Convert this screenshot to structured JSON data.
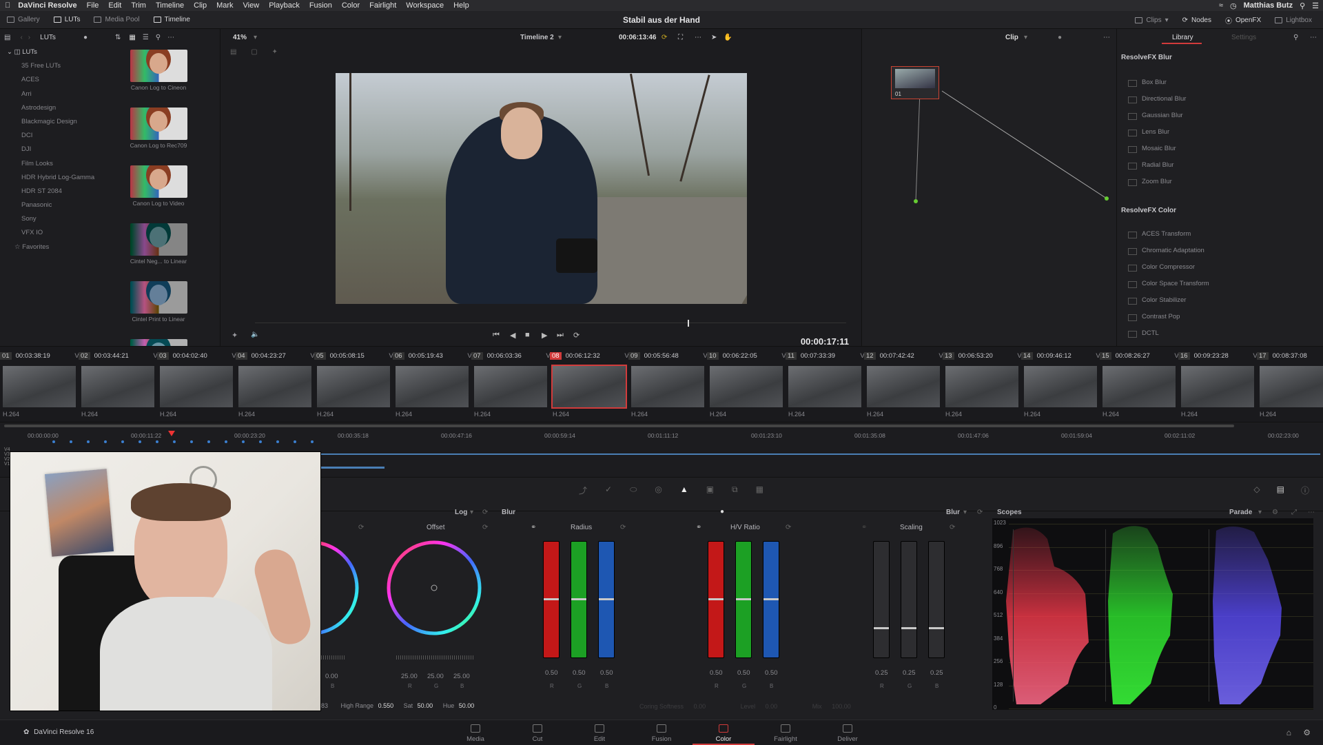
{
  "menubar": {
    "app": "DaVinci Resolve",
    "items": [
      "File",
      "Edit",
      "Trim",
      "Timeline",
      "Clip",
      "Mark",
      "View",
      "Playback",
      "Fusion",
      "Color",
      "Fairlight",
      "Workspace",
      "Help"
    ],
    "user": "Matthias Butz"
  },
  "toolbar": {
    "left": [
      "Gallery",
      "LUTs",
      "Media Pool",
      "Timeline"
    ],
    "project_title": "Stabil aus der Hand",
    "right": [
      "Clips",
      "Nodes",
      "OpenFX",
      "Lightbox"
    ]
  },
  "luts": {
    "panel_title": "LUTs",
    "tree_root": "LUTs",
    "tree": [
      "35 Free LUTs",
      "ACES",
      "Arri",
      "Astrodesign",
      "Blackmagic Design",
      "DCI",
      "DJI",
      "Film Looks",
      "HDR Hybrid Log-Gamma",
      "HDR ST 2084",
      "Panasonic",
      "Sony",
      "VFX IO",
      "Favorites"
    ],
    "thumbs": [
      "Canon Log to Cineon",
      "Canon Log to Rec709",
      "Canon Log to Video",
      "Cintel Neg... to Linear",
      "Cintel Print to Linear",
      ""
    ]
  },
  "viewer": {
    "zoom": "41%",
    "timeline_name": "Timeline 2",
    "timecode_top": "00:06:13:46",
    "timecode": "00:00:17:11",
    "clip_mode": "Clip"
  },
  "nodes": {
    "node_label": "01"
  },
  "library": {
    "tabs": [
      "Library",
      "Settings"
    ],
    "sections": [
      {
        "title": "ResolveFX Blur",
        "items": [
          "Box Blur",
          "Directional Blur",
          "Gaussian Blur",
          "Lens Blur",
          "Mosaic Blur",
          "Radial Blur",
          "Zoom Blur"
        ]
      },
      {
        "title": "ResolveFX Color",
        "items": [
          "ACES Transform",
          "Chromatic Adaptation",
          "Color Compressor",
          "Color Space Transform",
          "Color Stabilizer",
          "Contrast Pop",
          "DCTL"
        ]
      }
    ]
  },
  "clips": [
    {
      "num": "01",
      "tc": "00:03:38:19",
      "track": "V1",
      "codec": "H.264"
    },
    {
      "num": "02",
      "tc": "00:03:44:21",
      "track": "V1",
      "codec": "H.264"
    },
    {
      "num": "03",
      "tc": "00:04:02:40",
      "track": "V1",
      "codec": "H.264"
    },
    {
      "num": "04",
      "tc": "00:04:23:27",
      "track": "V1",
      "codec": "H.264"
    },
    {
      "num": "05",
      "tc": "00:05:08:15",
      "track": "V1",
      "codec": "H.264"
    },
    {
      "num": "06",
      "tc": "00:05:19:43",
      "track": "V1",
      "codec": "H.264"
    },
    {
      "num": "07",
      "tc": "00:06:03:36",
      "track": "V1",
      "codec": "H.264"
    },
    {
      "num": "08",
      "tc": "00:06:12:32",
      "track": "V1",
      "codec": "H.264"
    },
    {
      "num": "09",
      "tc": "00:05:56:48",
      "track": "V1",
      "codec": "H.264"
    },
    {
      "num": "10",
      "tc": "00:06:22:05",
      "track": "V1",
      "codec": "H.264"
    },
    {
      "num": "11",
      "tc": "00:07:33:39",
      "track": "V1",
      "codec": "H.264"
    },
    {
      "num": "12",
      "tc": "00:07:42:42",
      "track": "V1",
      "codec": "H.264"
    },
    {
      "num": "13",
      "tc": "00:06:53:20",
      "track": "V1",
      "codec": "H.264"
    },
    {
      "num": "14",
      "tc": "00:09:46:12",
      "track": "V1",
      "codec": "H.264"
    },
    {
      "num": "15",
      "tc": "00:08:26:27",
      "track": "V1",
      "codec": "H.264"
    },
    {
      "num": "16",
      "tc": "00:09:23:28",
      "track": "V1",
      "codec": "H.264"
    },
    {
      "num": "17",
      "tc": "00:08:37:08",
      "track": "V1",
      "codec": "H.264"
    }
  ],
  "ruler": [
    "00:00:00:00",
    "00:00:11:22",
    "00:00:23:20",
    "00:00:35:18",
    "00:00:47:16",
    "00:00:59:14",
    "00:01:11:12",
    "00:01:23:10",
    "00:01:35:08",
    "00:01:47:06",
    "00:01:59:04",
    "00:02:11:02",
    "00:02:23:00"
  ],
  "tracks": [
    "V4",
    "V3",
    "V2",
    "V1"
  ],
  "wheels": {
    "mode": "Log",
    "offset_title": "Offset",
    "left_val": "0.00",
    "left_ch": "B",
    "offset_vals": [
      "25.00",
      "25.00",
      "25.00"
    ],
    "offset_ch": [
      "R",
      "G",
      "B"
    ],
    "highrange_label": "High Range",
    "highrange": "0.550",
    "sat_label": "Sat",
    "sat": "50.00",
    "hue_label": "Hue",
    "hue": "50.00",
    "left_partial": "83"
  },
  "blur": {
    "title": "Blur",
    "mode": "Blur",
    "radius_title": "Radius",
    "ratio_title": "H/V Ratio",
    "scaling_title": "Scaling",
    "radius_vals": [
      "0.50",
      "0.50",
      "0.50"
    ],
    "ratio_vals": [
      "0.50",
      "0.50",
      "0.50"
    ],
    "scaling_vals": [
      "0.25",
      "0.25",
      "0.25"
    ],
    "ch": [
      "R",
      "G",
      "B"
    ],
    "footer": [
      "Coring Softness",
      "0.00",
      "Level",
      "0.00",
      "Mix",
      "100.00"
    ]
  },
  "scopes": {
    "title": "Scopes",
    "mode": "Parade",
    "ticks": [
      "1023",
      "896",
      "768",
      "640",
      "512",
      "384",
      "256",
      "128",
      "0"
    ]
  },
  "pages": {
    "version": "DaVinci Resolve 16",
    "items": [
      "Media",
      "Cut",
      "Edit",
      "Fusion",
      "Color",
      "Fairlight",
      "Deliver"
    ],
    "active": "Color"
  }
}
